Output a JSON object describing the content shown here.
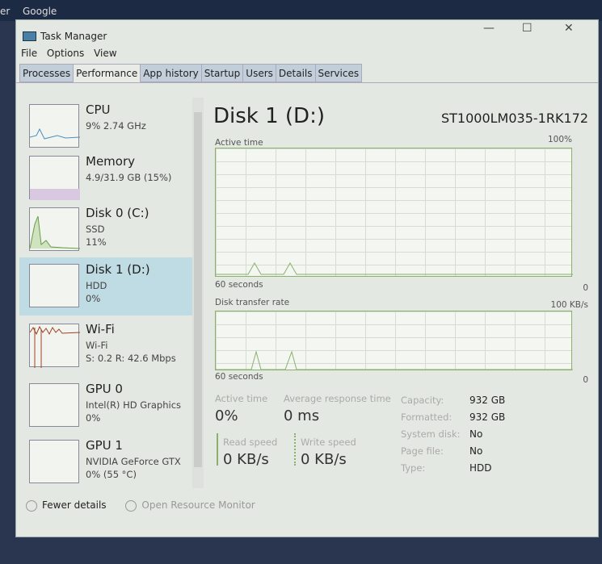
{
  "taskbar": {
    "left": "er",
    "app": "Google"
  },
  "window": {
    "title": "Task Manager",
    "minimize": "—",
    "maximize": "☐",
    "close": "✕"
  },
  "menu": [
    "File",
    "Options",
    "View"
  ],
  "tabs": [
    "Processes",
    "Performance",
    "App history",
    "Startup",
    "Users",
    "Details",
    "Services"
  ],
  "sidebar": [
    {
      "name": "CPU",
      "sub1": "9% 2.74 GHz"
    },
    {
      "name": "Memory",
      "sub1": "4.9/31.9 GB (15%)"
    },
    {
      "name": "Disk 0 (C:)",
      "sub1": "SSD",
      "sub2": "11%"
    },
    {
      "name": "Disk 1 (D:)",
      "sub1": "HDD",
      "sub2": "0%"
    },
    {
      "name": "Wi-Fi",
      "sub1": "Wi-Fi",
      "sub2": "S: 0.2  R: 42.6 Mbps"
    },
    {
      "name": "GPU 0",
      "sub1": "Intel(R) HD Graphics",
      "sub2": "0%"
    },
    {
      "name": "GPU 1",
      "sub1": "NVIDIA GeForce GTX",
      "sub2": "0% (55 °C)"
    }
  ],
  "main": {
    "title": "Disk 1 (D:)",
    "model": "ST1000LM035-1RK172",
    "graph1": {
      "label": "Active time",
      "max": "100%",
      "time": "60 seconds",
      "min": "0"
    },
    "graph2": {
      "label": "Disk transfer rate",
      "max": "100 KB/s",
      "time": "60 seconds",
      "min": "0"
    },
    "stats": {
      "active_label": "Active time",
      "active": "0%",
      "resp_label": "Average response time",
      "resp": "0 ms",
      "read_label": "Read speed",
      "read": "0 KB/s",
      "write_label": "Write speed",
      "write": "0 KB/s"
    },
    "props": [
      {
        "k": "Capacity:",
        "v": "932 GB"
      },
      {
        "k": "Formatted:",
        "v": "932 GB"
      },
      {
        "k": "System disk:",
        "v": "No"
      },
      {
        "k": "Page file:",
        "v": "No"
      },
      {
        "k": "Type:",
        "v": "HDD"
      }
    ]
  },
  "footer": {
    "fewer": "Fewer details",
    "monitor": "Open Resource Monitor"
  },
  "colors": {
    "accent": "#8ab06c",
    "selected": "#bfdbe3"
  }
}
